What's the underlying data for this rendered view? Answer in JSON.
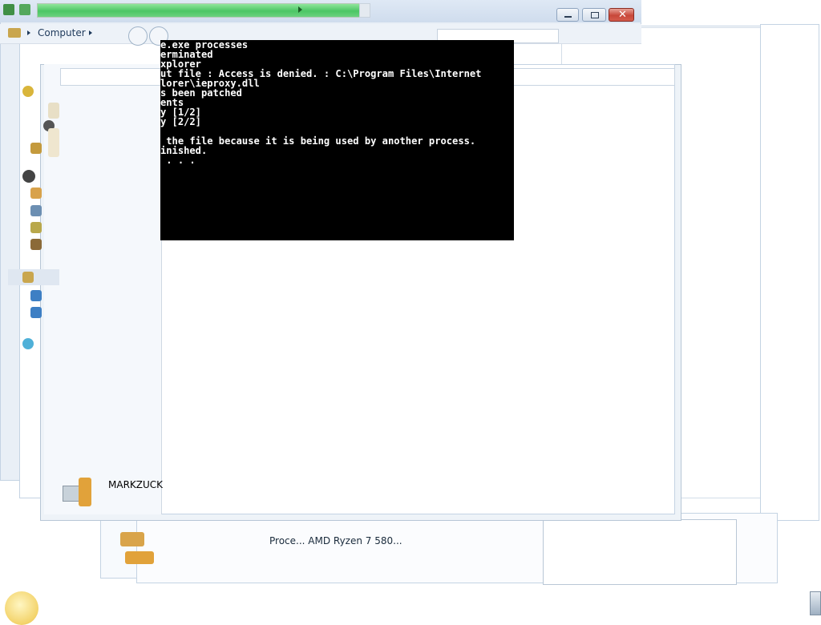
{
  "explorer": {
    "breadcrumb_root": "Computer"
  },
  "console": {
    "lines": [
      "e.exe processes",
      "erminated",
      "xplorer",
      "ut file : Access is denied. : C:\\Program Files\\Internet",
      "lorer\\ieproxy.dll",
      "s been patched",
      "ents",
      "y [1/2]",
      "y [2/2]",
      "",
      " the file because it is being used by another process.",
      "inished.",
      " . . ."
    ]
  },
  "start_menu": {
    "user_name": "MARKZUCK"
  },
  "taskbar_window": {
    "processor_text": "Proce... AMD Ryzen 7 580..."
  },
  "colors": {
    "console_bg": "#000000",
    "console_text": "#ffffff",
    "progress_green": "#4cc665",
    "close_red": "#c8483a",
    "window_border": "#c4d3e3"
  },
  "icons": [
    "star-icon",
    "folder-icon",
    "stack-icon",
    "disc-icon",
    "computer-icon",
    "media-icon",
    "drive-icon",
    "network-icon",
    "user-icon",
    "minimize-icon",
    "maximize-icon",
    "close-icon",
    "back-icon",
    "forward-icon",
    "smiley-icon"
  ]
}
